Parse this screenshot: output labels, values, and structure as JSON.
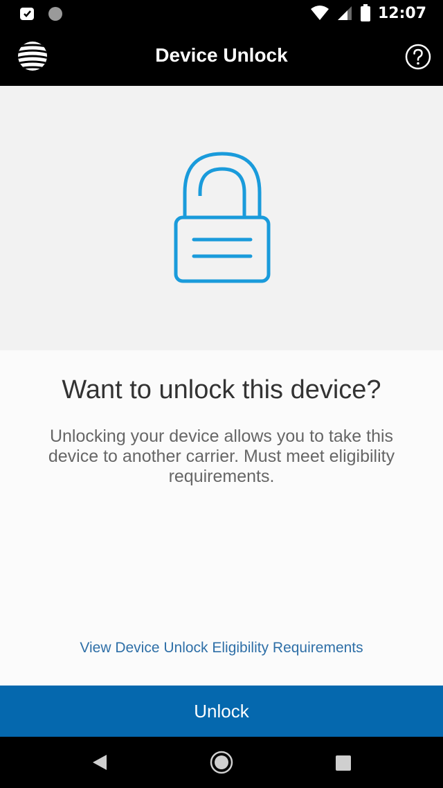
{
  "status_bar": {
    "time": "12:07",
    "icons": [
      "notification-icon",
      "circle-notification-icon",
      "wifi-icon",
      "signal-icon",
      "battery-icon"
    ]
  },
  "app_bar": {
    "title": "Device Unlock",
    "logo": "att-globe-logo",
    "help_icon": "help-icon"
  },
  "hero": {
    "icon": "padlock-icon",
    "icon_color": "#1a9bdb",
    "background": "#f2f2f2"
  },
  "content": {
    "heading": "Want to unlock this device?",
    "description": "Unlocking your device allows you to take this device to another carrier. Must meet eligibility requirements.",
    "eligibility_link": "View Device Unlock Eligibility Requirements"
  },
  "unlock_button": {
    "label": "Unlock",
    "color": "#0568ae"
  },
  "nav_bar": {
    "icons": [
      "back-icon",
      "home-icon",
      "recents-icon"
    ]
  }
}
